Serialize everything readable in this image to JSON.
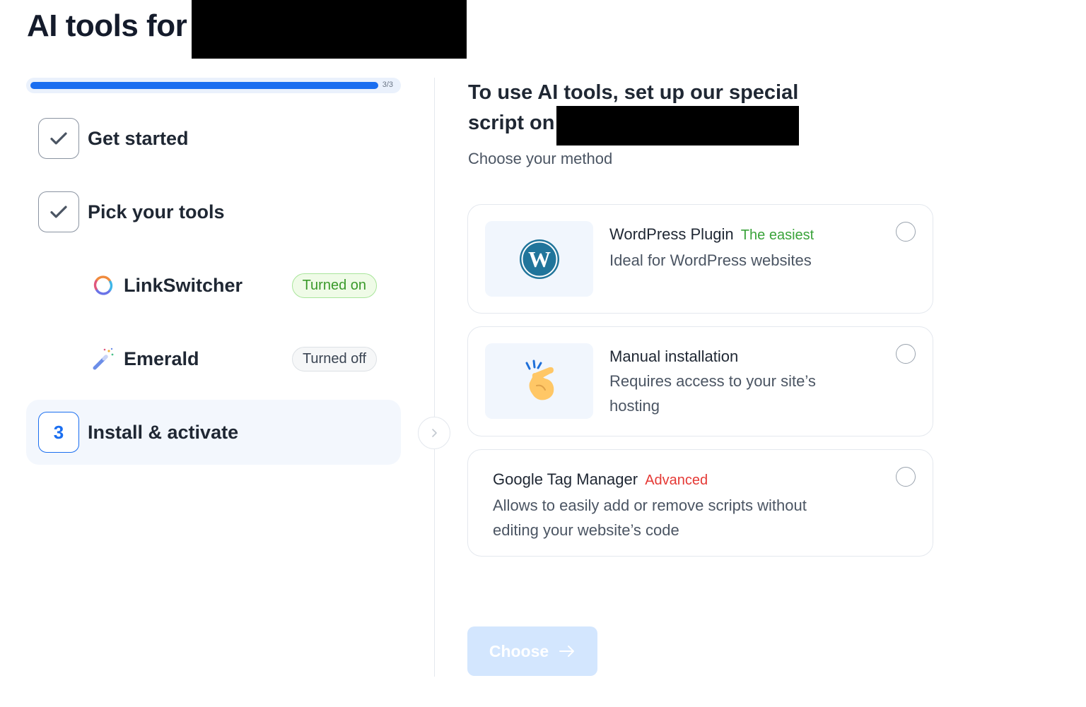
{
  "header": {
    "title": "AI tools for"
  },
  "progress": {
    "count": "3/3",
    "fraction": 1.0
  },
  "steps": [
    {
      "label": "Get started",
      "state": "done"
    },
    {
      "label": "Pick your tools",
      "state": "done"
    },
    {
      "label": "Install & activate",
      "number": "3",
      "state": "active"
    }
  ],
  "tools": [
    {
      "name": "LinkSwitcher",
      "status": "Turned on",
      "icon": "refresh-icon"
    },
    {
      "name": "Emerald",
      "status": "Turned off",
      "icon": "magic-wand-icon"
    }
  ],
  "main": {
    "heading_line1": "To use AI tools, set up our special",
    "heading_line2": "script on",
    "subheading": "Choose your method",
    "options": [
      {
        "title": "WordPress Plugin",
        "tag": "The easiest",
        "desc": "Ideal for WordPress websites",
        "icon": "wordpress-icon",
        "selected": false
      },
      {
        "title": "Manual installation",
        "tag": "",
        "desc_line1": "Requires access to your site’s",
        "desc_line2": "hosting",
        "icon": "pointing-hand-icon",
        "selected": false
      },
      {
        "title": "Google Tag Manager",
        "tag": "Advanced",
        "desc_line1": "Allows to easily add or remove scripts without",
        "desc_line2": "editing your website’s code",
        "selected": false
      }
    ],
    "choose_label": "Choose"
  },
  "colors": {
    "accent": "#1a6ef0",
    "badge_on": "#3a9a2a",
    "tag_green": "#3aa33a",
    "tag_red": "#e53935",
    "button_disabled": "#d3e6fe"
  }
}
